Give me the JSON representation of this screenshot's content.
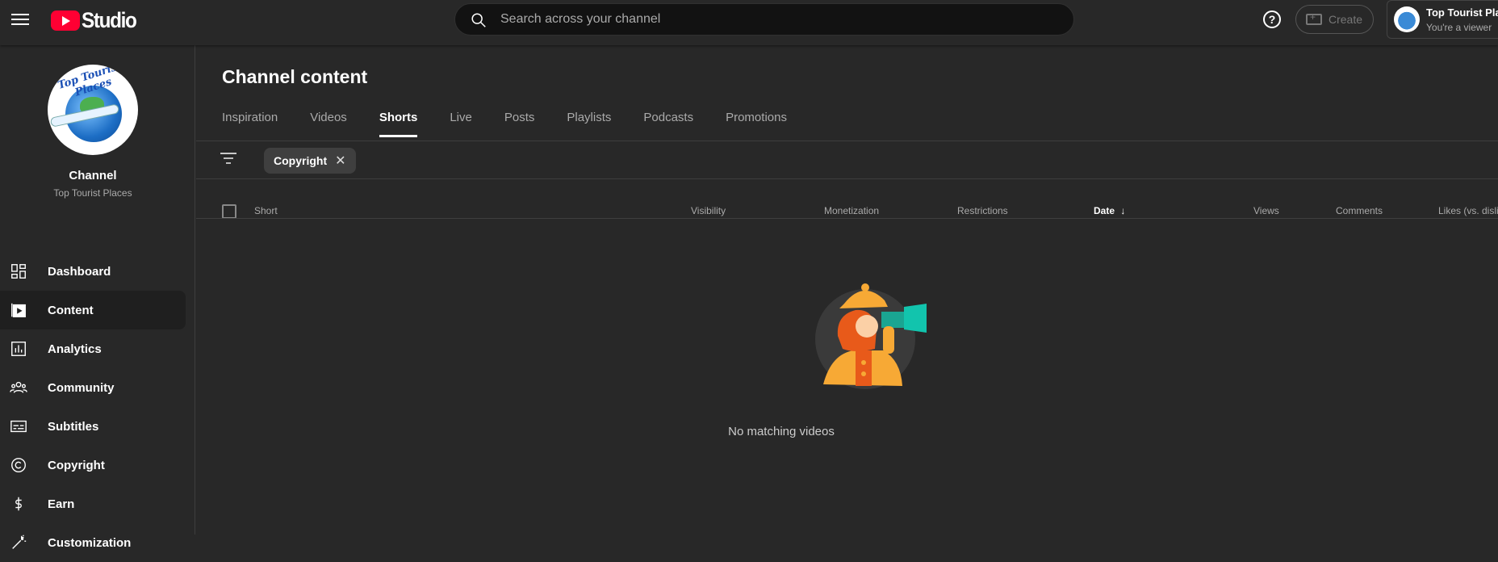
{
  "header": {
    "logo_text": "Studio",
    "search_placeholder": "Search across your channel",
    "help_label": "?",
    "create_label": "Create",
    "account": {
      "name": "Top Tourist Places",
      "role": "You're a viewer"
    }
  },
  "sidebar": {
    "channel_label": "Channel",
    "channel_name": "Top Tourist Places",
    "avatar_text": "Top Tourist Places",
    "items": [
      {
        "label": "Dashboard",
        "icon": "dashboard-icon",
        "active": false
      },
      {
        "label": "Content",
        "icon": "content-icon",
        "active": true
      },
      {
        "label": "Analytics",
        "icon": "analytics-icon",
        "active": false
      },
      {
        "label": "Community",
        "icon": "community-icon",
        "active": false
      },
      {
        "label": "Subtitles",
        "icon": "subtitles-icon",
        "active": false
      },
      {
        "label": "Copyright",
        "icon": "copyright-icon",
        "active": false
      },
      {
        "label": "Earn",
        "icon": "earn-icon",
        "active": false
      },
      {
        "label": "Customization",
        "icon": "customization-icon",
        "active": false
      }
    ]
  },
  "main": {
    "title": "Channel content",
    "tabs": [
      {
        "label": "Inspiration",
        "active": false
      },
      {
        "label": "Videos",
        "active": false
      },
      {
        "label": "Shorts",
        "active": true
      },
      {
        "label": "Live",
        "active": false
      },
      {
        "label": "Posts",
        "active": false
      },
      {
        "label": "Playlists",
        "active": false
      },
      {
        "label": "Podcasts",
        "active": false
      },
      {
        "label": "Promotions",
        "active": false
      }
    ],
    "filter_chip": "Copyright",
    "columns": {
      "short": "Short",
      "visibility": "Visibility",
      "monetization": "Monetization",
      "restrictions": "Restrictions",
      "date": "Date",
      "views": "Views",
      "comments": "Comments",
      "likes": "Likes (vs. dislikes)"
    },
    "empty_message": "No matching videos"
  },
  "colors": {
    "background": "#282828",
    "search_bg": "#121212",
    "brand_red": "#ff0033",
    "active_nav": "#1f1f1f"
  }
}
